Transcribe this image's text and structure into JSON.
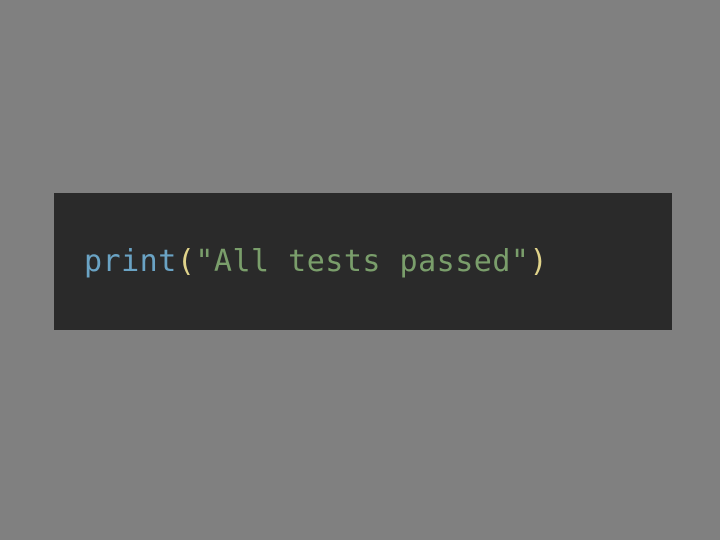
{
  "code": {
    "fn": "print",
    "open_paren": "(",
    "string": "\"All tests passed\"",
    "close_paren": ")"
  }
}
